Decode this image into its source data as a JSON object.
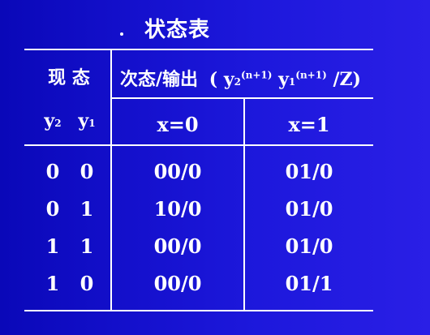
{
  "title": "状态表",
  "header": {
    "present_state_label": "现 态",
    "next_output_label": "次态/输出",
    "next_output_expr_open": "(",
    "y2": "y",
    "y2_sub": "2",
    "y2_sup": "(n+1)",
    "y1": "y",
    "y1_sub": "1",
    "y1_sup": "(n+1)",
    "expr_close": "/Z)",
    "var_y2": "y",
    "var_y2_sub": "2",
    "var_y1": "y",
    "var_y1_sub": "1",
    "input_x0": "x=0",
    "input_x1": "x=1"
  },
  "rows": [
    {
      "y2": "0",
      "y1": "0",
      "x0": "00/0",
      "x1": "01/0"
    },
    {
      "y2": "0",
      "y1": "1",
      "x0": "10/0",
      "x1": "01/0"
    },
    {
      "y2": "1",
      "y1": "1",
      "x0": "00/0",
      "x1": "01/0"
    },
    {
      "y2": "1",
      "y1": "0",
      "x0": "00/0",
      "x1": "01/1"
    }
  ]
}
